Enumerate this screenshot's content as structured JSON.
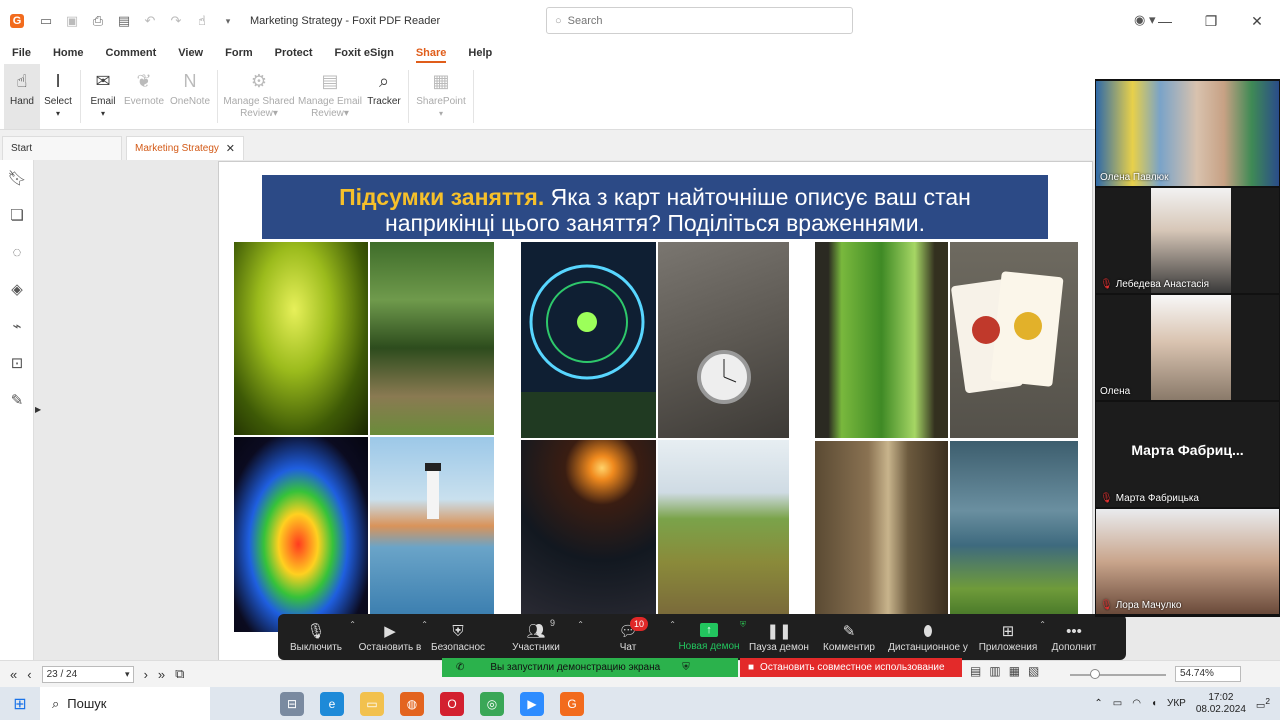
{
  "app": {
    "title": "Marketing Strategy - Foxit PDF Reader",
    "search_placeholder": "Search"
  },
  "menu": [
    "File",
    "Home",
    "Comment",
    "View",
    "Form",
    "Protect",
    "Foxit eSign",
    "Share",
    "Help"
  ],
  "menu_active": "Share",
  "ribbon": {
    "hand": "Hand",
    "select": "Select",
    "email": "Email",
    "evernote": "Evernote",
    "onenote": "OneNote",
    "manage_shared_review_1": "Manage Shared",
    "manage_shared_review_2": "Review",
    "manage_email_review_1": "Manage Email",
    "manage_email_review_2": "Review",
    "tracker": "Tracker",
    "sharepoint": "SharePoint"
  },
  "tabs": {
    "start": "Start",
    "doc": "Marketing Strategy"
  },
  "slide": {
    "highlight": "Підсумки заняття.",
    "line1": "Яка з карт найточніше описує ваш стан",
    "line2": "наприкінці цього заняття? Поділіться враженнями."
  },
  "meeting_toolbar": {
    "mute": "Выключить",
    "stop_video": "Остановить в",
    "security": "Безопаснос",
    "participants": "Участники",
    "participants_count": "9",
    "chat": "Чат",
    "chat_badge": "10",
    "new_share": "Новая демон",
    "pause_share": "Пауза демон",
    "annotate": "Комментир",
    "remote_control": "Дистанционное у",
    "apps": "Приложения",
    "more": "Дополнит"
  },
  "participants": [
    {
      "name": "Олена Павлюк",
      "muted": false,
      "video": true
    },
    {
      "name": "Лебедева Анастасія",
      "muted": true,
      "video": true
    },
    {
      "name": "Олена",
      "muted": false,
      "video": true
    },
    {
      "name": "Марта Фабрицька",
      "muted": true,
      "video": false,
      "display_name": "Марта  Фабриц..."
    },
    {
      "name": "Лора Мачулко",
      "muted": true,
      "video": true
    }
  ],
  "share_bar": {
    "notice": "Вы запустили демонстрацию экрана",
    "stop": "Остановить совместное использование"
  },
  "status": {
    "page": "23 / 24",
    "zoom": "54.74%"
  },
  "taskbar": {
    "search": "Пошук",
    "lang": "УКР",
    "time": "17:02",
    "date": "08.02.2024",
    "notif_count": "2"
  },
  "colors": {
    "accent": "#e05d1a",
    "banner": "#2c4a86",
    "banner_highlight": "#f6c02a",
    "share_green": "#2bb24c",
    "share_red": "#e32a2a"
  }
}
